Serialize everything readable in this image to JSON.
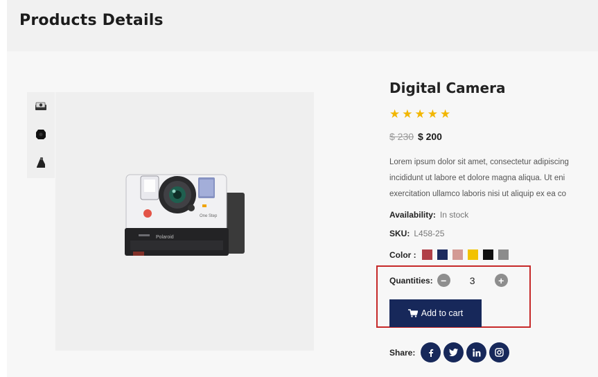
{
  "header": {
    "title": "Products Details"
  },
  "gallery": {
    "thumbnails": [
      "camera-front-thumbnail",
      "camera-dark-thumbnail",
      "camera-side-thumbnail"
    ],
    "main_image": "instant-camera-image",
    "camera_label": "Polaroid",
    "camera_badge": "One Step"
  },
  "product": {
    "title": "Digital Camera",
    "rating": 5,
    "stars": [
      "★",
      "★",
      "★",
      "★",
      "★"
    ],
    "old_price": "$ 230",
    "new_price": "$ 200",
    "description": [
      "Lorem ipsum dolor sit amet, consectetur adipiscing",
      "incididunt ut labore et dolore magna aliqua. Ut eni",
      "exercitation ullamco laboris nisi ut aliquip ex ea co"
    ],
    "availability_label": "Availability:",
    "availability_value": "In stock",
    "sku_label": "SKU:",
    "sku_value": "L458-25",
    "color_label": "Color :",
    "colors": [
      "#b04048",
      "#1c2a5e",
      "#d39a94",
      "#f2c200",
      "#111111",
      "#8c8c8c"
    ],
    "quantity_label": "Quantities:",
    "quantity_value": "3",
    "minus_symbol": "−",
    "plus_symbol": "+",
    "add_to_cart_label": "Add to cart",
    "share_label": "Share:",
    "social": [
      {
        "name": "facebook-icon",
        "glyph": "f"
      },
      {
        "name": "twitter-icon",
        "glyph": "t"
      },
      {
        "name": "linkedin-icon",
        "glyph": "in"
      },
      {
        "name": "instagram-icon",
        "glyph": "ig"
      }
    ]
  },
  "colors": {
    "accent": "#17285a",
    "star": "#f2b600",
    "highlight": "#c62828"
  }
}
